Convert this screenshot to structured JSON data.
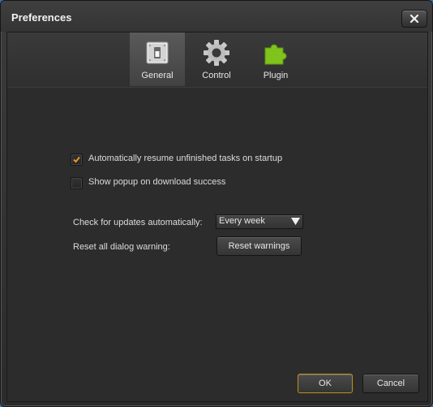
{
  "window": {
    "title": "Preferences"
  },
  "tabs": [
    {
      "label": "General",
      "icon": "switch-icon",
      "active": true
    },
    {
      "label": "Control",
      "icon": "gear-icon",
      "active": false
    },
    {
      "label": "Plugin",
      "icon": "puzzle-piece-icon",
      "active": false
    }
  ],
  "general": {
    "resume_tasks": {
      "label": "Automatically resume unfinished tasks on startup",
      "checked": true
    },
    "popup_on_success": {
      "label": "Show popup on download success",
      "checked": false
    },
    "updates": {
      "label": "Check for updates automatically:",
      "selected": "Every week"
    },
    "reset": {
      "label": "Reset all dialog warning:",
      "button": "Reset warnings"
    }
  },
  "footer": {
    "ok": "OK",
    "cancel": "Cancel"
  },
  "colors": {
    "accent_border": "#b2902e",
    "checkmark": "#e8962a",
    "plugin_green": "#7fc31c"
  }
}
